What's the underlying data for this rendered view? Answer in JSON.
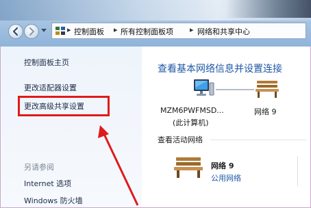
{
  "breadcrumb": {
    "items": [
      "控制面板",
      "所有控制面板项",
      "网络和共享中心"
    ]
  },
  "sidebar": {
    "home": "控制面板主页",
    "links": [
      "更改适配器设置",
      "更改高级共享设置"
    ],
    "see_also": "另请参阅",
    "extra_links": [
      "Internet 选项",
      "Windows 防火墙"
    ]
  },
  "main": {
    "title": "查看基本网络信息并设置连接",
    "computer_name": "MZM6PWFMSD...",
    "computer_sub": "(此计算机)",
    "network_label": "网络  9",
    "active_section": "查看活动网络",
    "active_network_name": "网络  9",
    "active_network_type": "公用网络"
  },
  "colors": {
    "highlight": "#e01a1a",
    "link_blue": "#1f57a6"
  },
  "icons": {
    "back": "back-arrow-icon",
    "forward": "forward-arrow-icon",
    "computer": "computer-icon",
    "network": "bench-network-icon"
  }
}
